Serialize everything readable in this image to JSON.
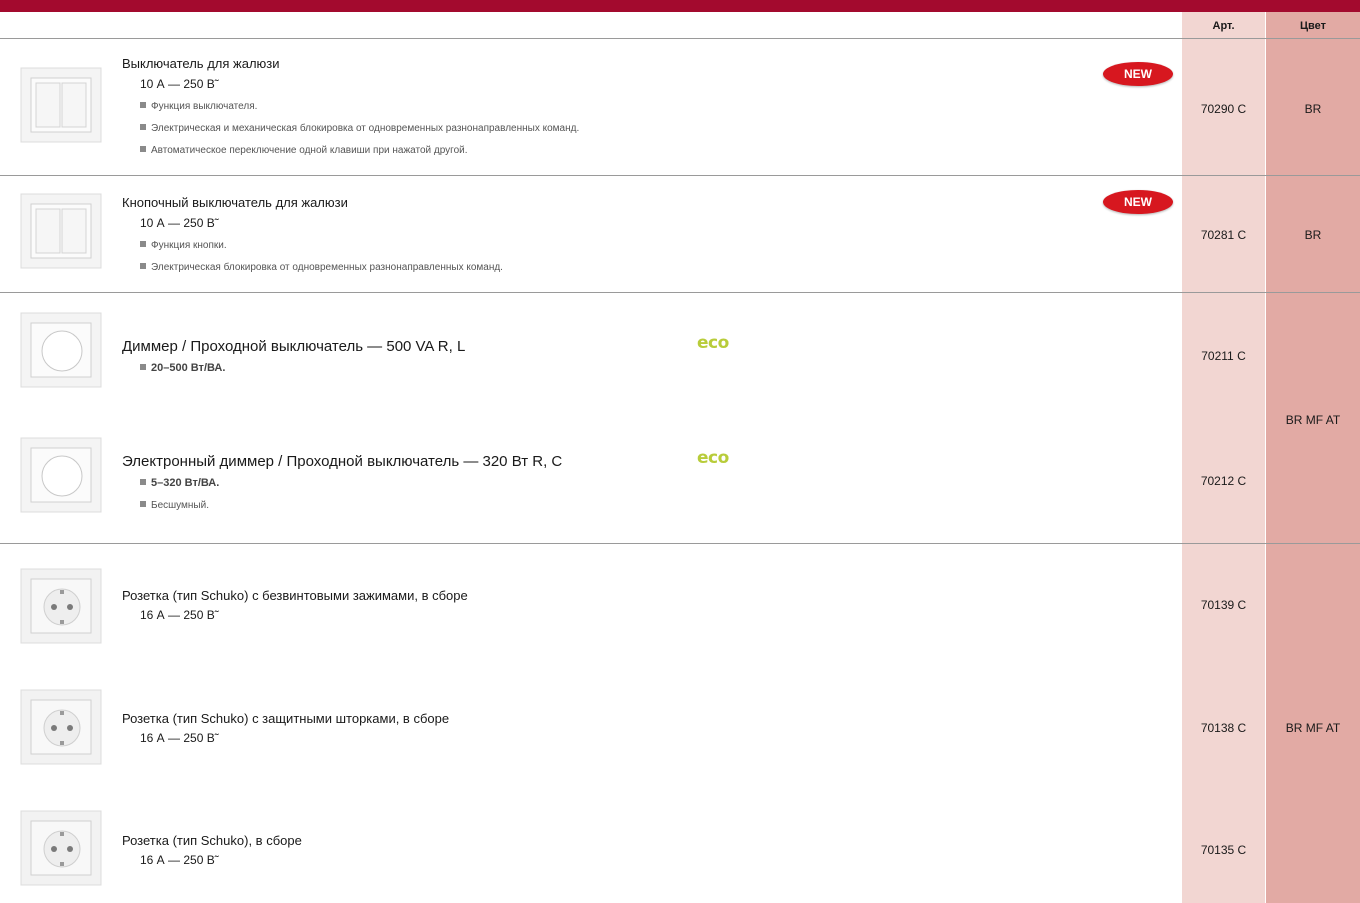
{
  "header": {
    "art_label": "Арт.",
    "color_label": "Цвет"
  },
  "products": [
    {
      "title": "Выключатель для жалюзи",
      "rating": "10 А — 250 В˜",
      "bullets": [
        "Функция выключателя.",
        "Электрическая и механическая блокировка от одновременных разнонаправленных команд.",
        "Автоматическое переключение одной клавиши при нажатой другой."
      ],
      "badge": "NEW",
      "art": "70290 C",
      "color": "BR"
    },
    {
      "title": "Кнопочный выключатель для жалюзи",
      "rating": "10 А — 250 В˜",
      "bullets": [
        "Функция кнопки.",
        "Электрическая блокировка от одновременных разнонаправленных команд."
      ],
      "badge": "NEW",
      "art": "70281 C",
      "color": "BR"
    },
    {
      "title": "Диммер / Проходной выключатель — 500 VA R, L",
      "bullets": [
        "20–500 Вт/ВА."
      ],
      "badge": "eco",
      "art": "70211 C"
    },
    {
      "title": "Электронный диммер / Проходной выключатель — 320 Вт R, C",
      "bullets": [
        "5–320 Вт/ВА.",
        "Бесшумный."
      ],
      "badge": "eco",
      "art": "70212 C"
    },
    {
      "title": "Розетка (тип Schuko) с безвинтовыми зажимами, в сборе",
      "rating": "16 А — 250 В˜",
      "art": "70139 C"
    },
    {
      "title": "Розетка (тип Schuko) с защитными шторками, в сборе",
      "rating": "16 А — 250 В˜",
      "art": "70138 C"
    },
    {
      "title": "Розетка (тип Schuko), в сборе",
      "rating": "16 А — 250 В˜",
      "art": "70135 C"
    }
  ],
  "group_colors": {
    "dimmers": "BR MF AT",
    "sockets": "BR MF AT"
  },
  "colors": {
    "brand_bar": "#a30a2e",
    "art_column": "#f2d6d2",
    "color_column": "#e2aaa4",
    "new_badge": "#d7171f",
    "eco": "#b8cc3a"
  },
  "icons": {
    "switch": "double-rocker-switch-icon",
    "dimmer": "rotary-dimmer-icon",
    "socket": "schuko-socket-icon"
  }
}
